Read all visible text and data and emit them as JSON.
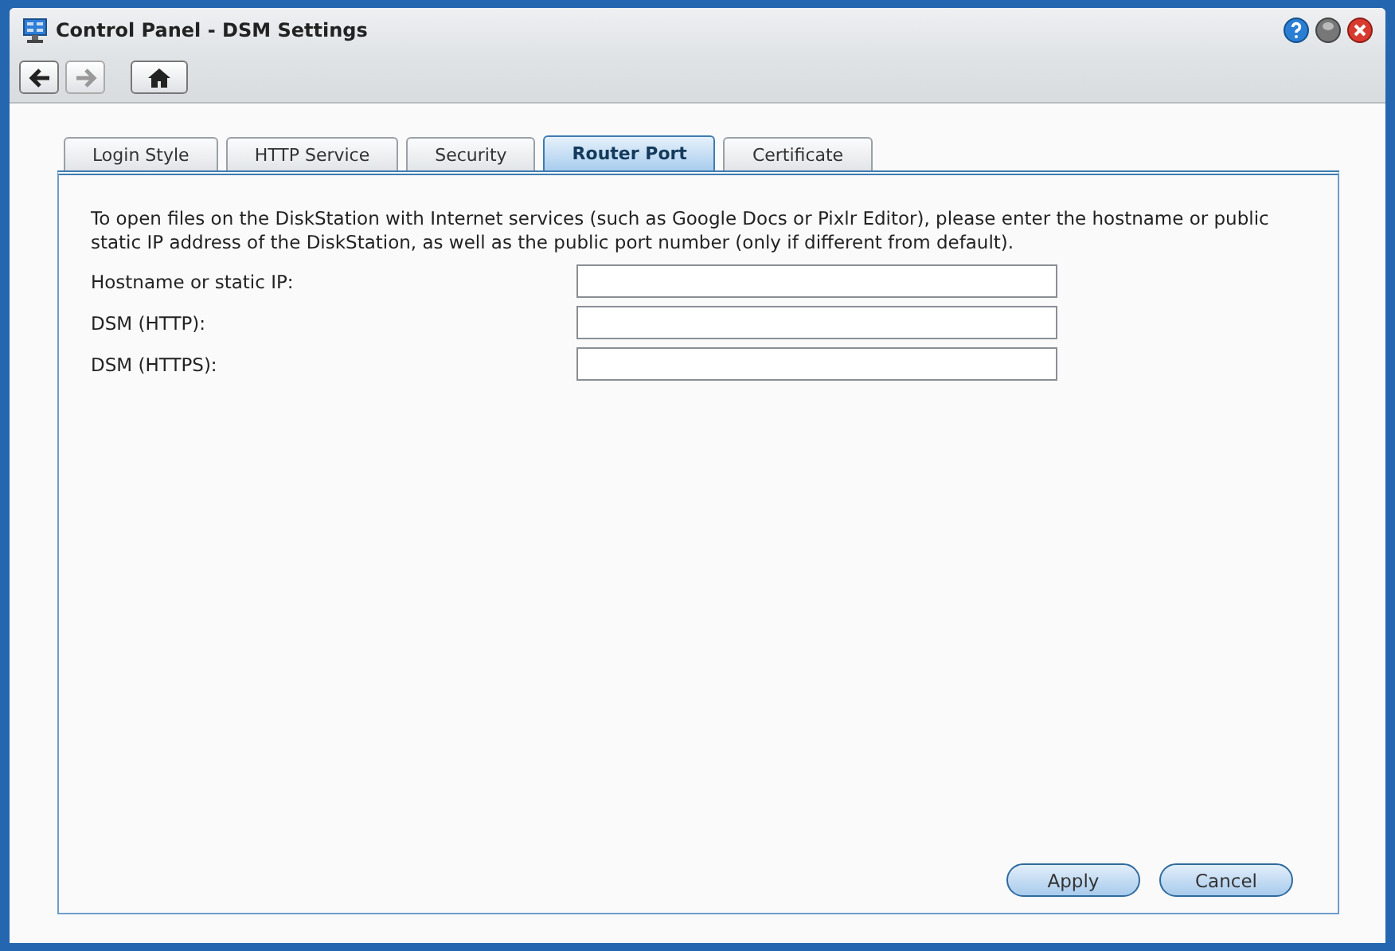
{
  "window": {
    "title": "Control Panel - DSM Settings"
  },
  "nav": [
    {
      "kind": "back",
      "disabled": false
    },
    {
      "kind": "forward",
      "disabled": true
    },
    {
      "kind": "home",
      "disabled": false
    }
  ],
  "tabs": [
    {
      "label": "Login Style",
      "selected": false
    },
    {
      "label": "HTTP Service",
      "selected": false
    },
    {
      "label": "Security",
      "selected": false
    },
    {
      "label": "Router Port",
      "selected": true
    },
    {
      "label": "Certificate",
      "selected": false
    }
  ],
  "description": "To open files on the DiskStation with Internet services (such as Google Docs or Pixlr Editor), please enter the hostname or public static IP address of the DiskStation, as well as the public port number (only if different from default).",
  "fields": [
    {
      "label": "Hostname or static IP:"
    },
    {
      "label": "DSM (HTTP):"
    },
    {
      "label": "DSM (HTTPS):"
    }
  ],
  "buttons": [
    "Apply",
    "Cancel"
  ]
}
